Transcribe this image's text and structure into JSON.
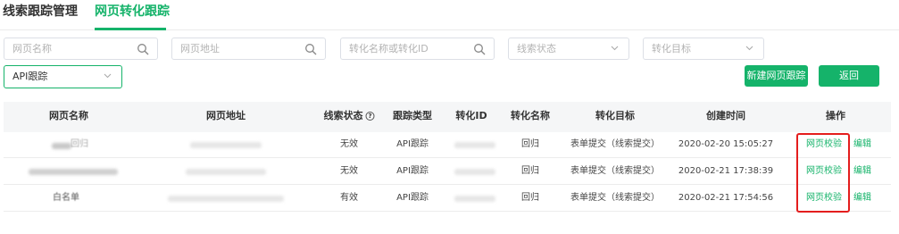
{
  "tabs": [
    {
      "label": "线索跟踪管理"
    },
    {
      "label": "网页转化跟踪"
    }
  ],
  "filters": {
    "page_name_placeholder": "网页名称",
    "page_url_placeholder": "网页地址",
    "conversion_placeholder": "转化名称或转化ID",
    "lead_status_placeholder": "线索状态",
    "conversion_goal_placeholder": "转化目标",
    "tracking_type_value": "API跟踪"
  },
  "actions": {
    "new_label": "新建网页跟踪",
    "back_label": "返回"
  },
  "table": {
    "headers": [
      "网页名称",
      "网页地址",
      "线索状态",
      "跟踪类型",
      "转化ID",
      "转化名称",
      "转化目标",
      "创建时间",
      "操作"
    ],
    "rows": [
      {
        "page_name": "回归",
        "lead_status": "无效",
        "tracking_type": "API跟踪",
        "conversion_name": "回归",
        "conversion_goal": "表单提交（线索提交）",
        "created_time": "2020-02-20 15:05:27",
        "verify_label": "网页校验",
        "edit_label": "编辑"
      },
      {
        "page_name": "",
        "lead_status": "无效",
        "tracking_type": "API跟踪",
        "conversion_name": "回归",
        "conversion_goal": "表单提交（线索提交）",
        "created_time": "2020-02-21 17:38:39",
        "verify_label": "网页校验",
        "edit_label": "编辑"
      },
      {
        "page_name": "白名单",
        "lead_status": "有效",
        "tracking_type": "API跟踪",
        "conversion_name": "回归",
        "conversion_goal": "表单提交（线索提交）",
        "created_time": "2020-02-21 17:54:56",
        "verify_label": "网页校验",
        "edit_label": "编辑"
      }
    ]
  },
  "colors": {
    "accent": "#15b36a",
    "highlight": "#e41d1d"
  }
}
